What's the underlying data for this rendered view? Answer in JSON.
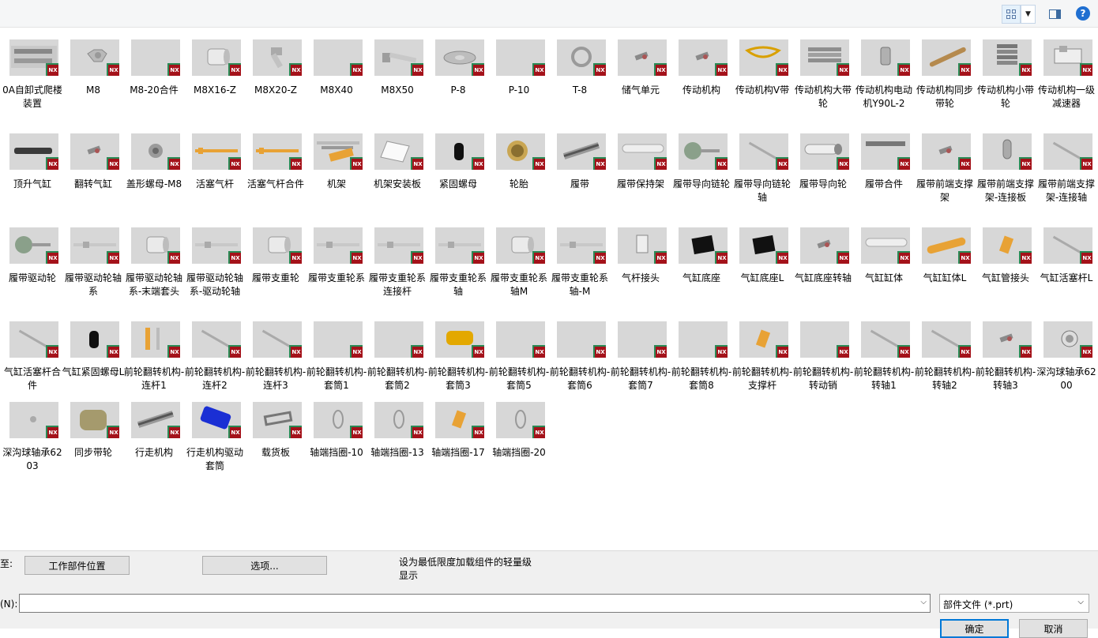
{
  "toolbar": {
    "view_icon": "thumbnails-view-icon",
    "dropdown_icon": "chevron-down-icon",
    "pane_icon": "preview-pane-icon",
    "help_icon": "help-icon",
    "help_text": "?"
  },
  "badge_text": "NX",
  "files": [
    {
      "name": "0A自卸式爬楼装置",
      "shape": "assembly"
    },
    {
      "name": "M8",
      "shape": "nut"
    },
    {
      "name": "M8-20合件",
      "shape": "blank"
    },
    {
      "name": "M8X16-Z",
      "shape": "cylinder"
    },
    {
      "name": "M8X20-Z",
      "shape": "bolt-short"
    },
    {
      "name": "M8X40",
      "shape": "blank"
    },
    {
      "name": "M8X50",
      "shape": "bolt-long"
    },
    {
      "name": "P-8",
      "shape": "washer"
    },
    {
      "name": "P-10",
      "shape": "blank"
    },
    {
      "name": "T-8",
      "shape": "ring"
    },
    {
      "name": "储气单元",
      "shape": "small-part"
    },
    {
      "name": "传动机构",
      "shape": "small-part"
    },
    {
      "name": "传动机构V带",
      "shape": "belt"
    },
    {
      "name": "传动机构大带轮",
      "shape": "pulley"
    },
    {
      "name": "传动机构电动机Y90L-2",
      "shape": "motor"
    },
    {
      "name": "传动机构同步带轮",
      "shape": "rod-diag"
    },
    {
      "name": "传动机构小带轮",
      "shape": "pulley-small"
    },
    {
      "name": "传动机构一级减速器",
      "shape": "gearbox"
    },
    {
      "name": "顶升气缸",
      "shape": "cylinder-dark"
    },
    {
      "name": "翻转气缸",
      "shape": "small-part"
    },
    {
      "name": "盖形螺母-M8",
      "shape": "nut-cap"
    },
    {
      "name": "活塞气杆",
      "shape": "orange-rod"
    },
    {
      "name": "活塞气杆合件",
      "shape": "orange-rod"
    },
    {
      "name": "机架",
      "shape": "frame"
    },
    {
      "name": "机架安装板",
      "shape": "plate"
    },
    {
      "name": "紧固螺母",
      "shape": "black-cyl"
    },
    {
      "name": "轮胎",
      "shape": "wheel"
    },
    {
      "name": "履带",
      "shape": "track"
    },
    {
      "name": "履带保持架",
      "shape": "bar-light"
    },
    {
      "name": "履带导向链轮",
      "shape": "sprocket"
    },
    {
      "name": "履带导向链轮轴",
      "shape": "rod-diag-thin"
    },
    {
      "name": "履带导向轮",
      "shape": "roller"
    },
    {
      "name": "履带合件",
      "shape": "track-small"
    },
    {
      "name": "履带前端支撑架",
      "shape": "small-part"
    },
    {
      "name": "履带前端支撑架-连接板",
      "shape": "link"
    },
    {
      "name": "履带前端支撑架-连接轴",
      "shape": "rod-diag-thin"
    },
    {
      "name": "履带驱动轮",
      "shape": "sprocket"
    },
    {
      "name": "履带驱动轮轴系",
      "shape": "shaft"
    },
    {
      "name": "履带驱动轮轴系-末端套头",
      "shape": "cylinder"
    },
    {
      "name": "履带驱动轮轴系-驱动轮轴",
      "shape": "shaft"
    },
    {
      "name": "履带支重轮",
      "shape": "cylinder"
    },
    {
      "name": "履带支重轮系",
      "shape": "shaft"
    },
    {
      "name": "履带支重轮系连接杆",
      "shape": "shaft"
    },
    {
      "name": "履带支重轮系轴",
      "shape": "shaft"
    },
    {
      "name": "履带支重轮系轴M",
      "shape": "cylinder"
    },
    {
      "name": "履带支重轮系轴-M",
      "shape": "shaft"
    },
    {
      "name": "气杆接头",
      "shape": "clevis"
    },
    {
      "name": "气缸底座",
      "shape": "black-block"
    },
    {
      "name": "气缸底座L",
      "shape": "black-block"
    },
    {
      "name": "气缸底座转轴",
      "shape": "small-part"
    },
    {
      "name": "气缸缸体",
      "shape": "bar-light"
    },
    {
      "name": "气缸缸体L",
      "shape": "orange-bar"
    },
    {
      "name": "气缸管接头",
      "shape": "orange-small"
    },
    {
      "name": "气缸活塞杆L",
      "shape": "rod-diag-thin"
    },
    {
      "name": "气缸活塞杆合件",
      "shape": "rod-diag-thin"
    },
    {
      "name": "气缸紧固螺母L",
      "shape": "black-cyl"
    },
    {
      "name": "前轮翻转机构-连杆1",
      "shape": "orange-pair"
    },
    {
      "name": "前轮翻转机构-连杆2",
      "shape": "rod-diag-thin"
    },
    {
      "name": "前轮翻转机构-连杆3",
      "shape": "rod-diag-thin"
    },
    {
      "name": "前轮翻转机构-套筒1",
      "shape": "blank"
    },
    {
      "name": "前轮翻转机构-套筒2",
      "shape": "blank"
    },
    {
      "name": "前轮翻转机构-套筒3",
      "shape": "orange-cyl"
    },
    {
      "name": "前轮翻转机构-套筒5",
      "shape": "blank"
    },
    {
      "name": "前轮翻转机构-套筒6",
      "shape": "blank"
    },
    {
      "name": "前轮翻转机构-套筒7",
      "shape": "blank"
    },
    {
      "name": "前轮翻转机构-套筒8",
      "shape": "blank"
    },
    {
      "name": "前轮翻转机构-支撑杆",
      "shape": "orange-small"
    },
    {
      "name": "前轮翻转机构-转动销",
      "shape": "blank"
    },
    {
      "name": "前轮翻转机构-转轴1",
      "shape": "rod-diag-thin"
    },
    {
      "name": "前轮翻转机构-转轴2",
      "shape": "rod-diag-thin"
    },
    {
      "name": "前轮翻转机构-转轴3",
      "shape": "small-part"
    },
    {
      "name": "深沟球轴承6200",
      "shape": "bearing"
    },
    {
      "name": "深沟球轴承6203",
      "shape": "bearing-small"
    },
    {
      "name": "同步带轮",
      "shape": "gear"
    },
    {
      "name": "行走机构",
      "shape": "track"
    },
    {
      "name": "行走机构驱动套筒",
      "shape": "blue-cyl"
    },
    {
      "name": "载货板",
      "shape": "tray"
    },
    {
      "name": "轴端挡圈-10",
      "shape": "clip"
    },
    {
      "name": "轴端挡圈-13",
      "shape": "clip"
    },
    {
      "name": "轴端挡圈-17",
      "shape": "orange-small"
    },
    {
      "name": "轴端挡圈-20",
      "shape": "clip"
    }
  ],
  "bottom": {
    "to_label": "至:",
    "work_part_btn": "工作部件位置",
    "options_btn": "选项...",
    "info_text": "设为最低限度加载组件的轻量级显示",
    "name_label": "(N):",
    "name_value": "",
    "filter_value": "部件文件 (*.prt)",
    "ok_btn": "确定",
    "cancel_btn": "取消"
  },
  "colors": {
    "badge": "#a4121a",
    "badge_edge": "#2a8a55",
    "thumb_bg": "#d7d7d7"
  }
}
